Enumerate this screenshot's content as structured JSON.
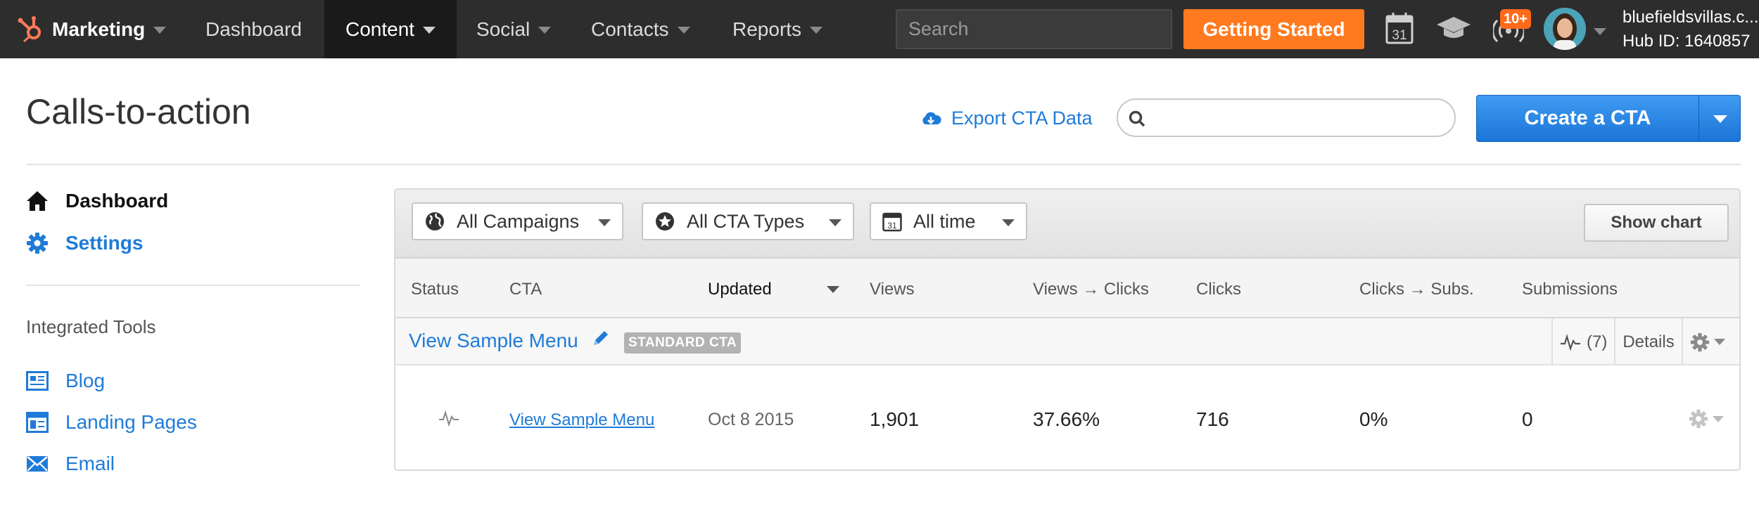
{
  "topnav": {
    "brand": "Marketing",
    "items": [
      {
        "label": "Dashboard"
      },
      {
        "label": "Content"
      },
      {
        "label": "Social"
      },
      {
        "label": "Contacts"
      },
      {
        "label": "Reports"
      }
    ],
    "search_placeholder": "Search",
    "getting_started": "Getting Started",
    "calendar_day": "31",
    "notifications_badge": "10+",
    "account_name": "bluefieldsvillas.c...",
    "hub_id": "Hub ID: 1640857",
    "colors": {
      "bar": "#2d2d2d",
      "accent": "#ff7a1f"
    }
  },
  "header": {
    "title": "Calls-to-action",
    "export_label": "Export CTA Data",
    "search_placeholder": "",
    "create_label": "Create a CTA"
  },
  "sidebar": {
    "items": [
      {
        "label": "Dashboard",
        "icon": "home-icon"
      },
      {
        "label": "Settings",
        "icon": "gear-icon"
      }
    ],
    "tools_heading": "Integrated Tools",
    "tools": [
      {
        "label": "Blog",
        "icon": "blog-icon"
      },
      {
        "label": "Landing Pages",
        "icon": "landing-pages-icon"
      },
      {
        "label": "Email",
        "icon": "email-icon"
      }
    ]
  },
  "filters": {
    "campaign": "All Campaigns",
    "cta_type": "All CTA Types",
    "time": "All time",
    "calendar_day": "31",
    "show_chart": "Show chart"
  },
  "table": {
    "columns": [
      "Status",
      "CTA",
      "Updated",
      "Views",
      "Views → Clicks",
      "Clicks",
      "Clicks → Subs.",
      "Submissions"
    ],
    "group": {
      "title": "View Sample Menu",
      "tag": "STANDARD CTA",
      "variations": "(7)",
      "details": "Details"
    },
    "rows": [
      {
        "cta": "View Sample Menu",
        "updated": "Oct 8 2015",
        "views": "1,901",
        "views_to_clicks": "37.66%",
        "clicks": "716",
        "clicks_to_subs": "0%",
        "submissions": "0"
      }
    ]
  }
}
